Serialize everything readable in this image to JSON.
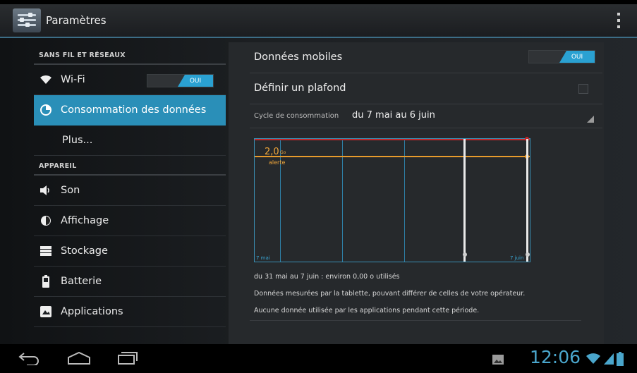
{
  "action_bar": {
    "title": "Paramètres",
    "app_icon": "settings-sliders-icon",
    "overflow_icon": "overflow-menu-icon"
  },
  "sidebar": {
    "sections": [
      {
        "header": "SANS FIL ET RÉSEAUX"
      },
      {
        "header": "APPAREIL"
      }
    ],
    "items": [
      {
        "label": "Wi-Fi",
        "icon": "wifi-icon",
        "toggle": "OUI"
      },
      {
        "label": "Consommation des données",
        "icon": "data-usage-icon",
        "selected": true
      },
      {
        "label": "Plus..."
      },
      {
        "label": "Son",
        "icon": "speaker-icon"
      },
      {
        "label": "Affichage",
        "icon": "brightness-icon"
      },
      {
        "label": "Stockage",
        "icon": "storage-icon"
      },
      {
        "label": "Batterie",
        "icon": "battery-icon"
      },
      {
        "label": "Applications",
        "icon": "applications-icon"
      }
    ]
  },
  "detail": {
    "mobile_data": {
      "label": "Données mobiles",
      "toggle": "OUI"
    },
    "set_limit": {
      "label": "Définir un plafond",
      "checked": false
    },
    "cycle": {
      "label": "Cycle de consommation",
      "value": "du 7 mai au 6 juin"
    },
    "chart": {
      "warning_value": "2,0",
      "warning_unit": "Go",
      "warning_label": "alerte",
      "start_label": "7 mai",
      "end_label": "7 juin"
    },
    "info": [
      "du 31 mai au 7 juin : environ 0,00 o utilisés",
      "Données mesurées par la tablette, pouvant différer de celles de votre opérateur.",
      "Aucune donnée utilisée par les applications pendant cette période."
    ]
  },
  "navbar": {
    "back_icon": "back-icon",
    "home_icon": "home-icon",
    "recents_icon": "recent-apps-icon",
    "gallery_icon": "image-notification-icon",
    "clock": "12:06",
    "wifi_icon": "wifi-status-icon",
    "signal_icon": "signal-icon",
    "battery_icon": "battery-status-icon"
  },
  "colors": {
    "accent": "#2a8fb8",
    "toggle_on": "#2aa1d2",
    "warning": "#e89b2c",
    "limit": "#c0282a",
    "clock": "#4aa6cc"
  }
}
